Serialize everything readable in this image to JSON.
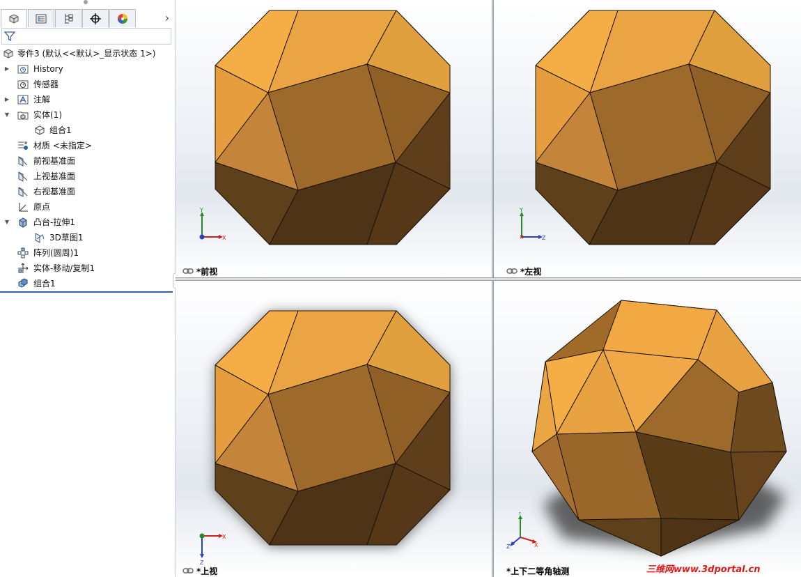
{
  "tabs": [
    {
      "name": "feature-manager",
      "icon": "featuremanager-icon"
    },
    {
      "name": "property-manager",
      "icon": "propertymanager-icon"
    },
    {
      "name": "configuration-manager",
      "icon": "configurationmanager-icon"
    },
    {
      "name": "dimxpert-manager",
      "icon": "dimxpert-icon"
    },
    {
      "name": "display-manager",
      "icon": "displaymanager-icon"
    }
  ],
  "filter": {
    "icon": "filter-icon",
    "value": ""
  },
  "tree": {
    "root": "零件3  (默认<<默认>_显示状态 1>)",
    "items": [
      {
        "label": "History",
        "icon": "history-folder-icon"
      },
      {
        "label": "传感器",
        "icon": "sensor-icon"
      },
      {
        "label": "注解",
        "icon": "annotation-icon"
      },
      {
        "label": "实体(1)",
        "icon": "solid-bodies-icon"
      },
      {
        "label": "组合1",
        "icon": "body-icon"
      },
      {
        "label": "材质 <未指定>",
        "icon": "material-icon"
      },
      {
        "label": "前视基准面",
        "icon": "plane-icon"
      },
      {
        "label": "上视基准面",
        "icon": "plane-icon"
      },
      {
        "label": "右视基准面",
        "icon": "plane-icon"
      },
      {
        "label": "原点",
        "icon": "origin-icon"
      },
      {
        "label": "凸台-拉伸1",
        "icon": "extrude-icon"
      },
      {
        "label": "3D草图1",
        "icon": "sketch3d-icon"
      },
      {
        "label": "阵列(圆周)1",
        "icon": "circular-pattern-icon"
      },
      {
        "label": "实体-移动/复制1",
        "icon": "move-copy-icon"
      },
      {
        "label": "组合1",
        "icon": "combine-icon"
      }
    ]
  },
  "viewports": {
    "front": {
      "label": "*前视",
      "triad": {
        "a": "Y",
        "b": "X"
      }
    },
    "left": {
      "label": "*左视",
      "triad": {
        "a": "Y",
        "b": "Z"
      }
    },
    "top": {
      "label": "*上视",
      "triad": {
        "a": "X",
        "b": "Z"
      }
    },
    "iso": {
      "label": "*上下二等角轴测",
      "triad": {
        "a": "Y",
        "b": "X",
        "c": "Z"
      }
    }
  },
  "colors": {
    "face_light": "#f2a944",
    "face_mid": "#a06a28",
    "face_dark": "#5a3a18",
    "accent": "#2a62b4"
  },
  "watermark": "三维网www.3dportal.cn"
}
